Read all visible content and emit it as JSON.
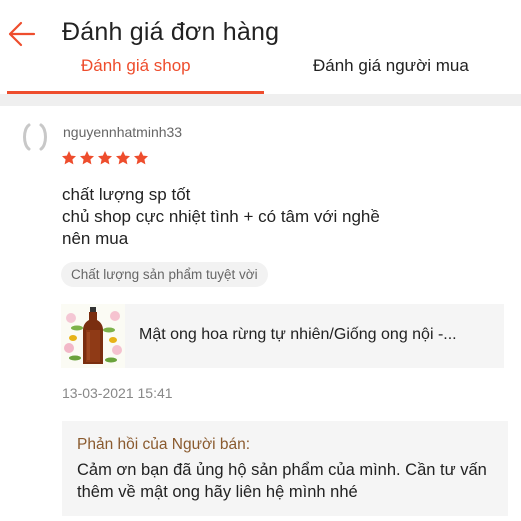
{
  "header": {
    "back_icon": "arrow-left-icon",
    "title": "Đánh giá đơn hàng"
  },
  "tabs": [
    {
      "label": "Đánh giá shop",
      "active": true
    },
    {
      "label": "Đánh giá người mua",
      "active": false
    }
  ],
  "colors": {
    "accent": "#ee4d2d",
    "star": "#ee4d2d",
    "reply_title": "#8a5a2e"
  },
  "review": {
    "avatar_icon": "avatar-placeholder-icon",
    "username": "nguyennhatminh33",
    "rating": 5,
    "rating_max": 5,
    "lines": [
      "chất lượng sp tốt",
      "chủ shop cực nhiệt tình + có tâm với nghề",
      "nên mua"
    ],
    "tag": "Chất lượng sản phẩm tuyệt vời",
    "product": {
      "thumb_icon": "honey-bottle-image",
      "name": "Mật ong hoa rừng tự nhiên/Giống ong nội -..."
    },
    "date": "13-03-2021 15:41",
    "seller_reply": {
      "title": "Phản hồi của Người bán:",
      "text": "Cảm ơn bạn đã ủng hộ sản phẩm của mình. Cần tư vấn thêm về mật ong hãy liên hệ mình nhé"
    }
  }
}
